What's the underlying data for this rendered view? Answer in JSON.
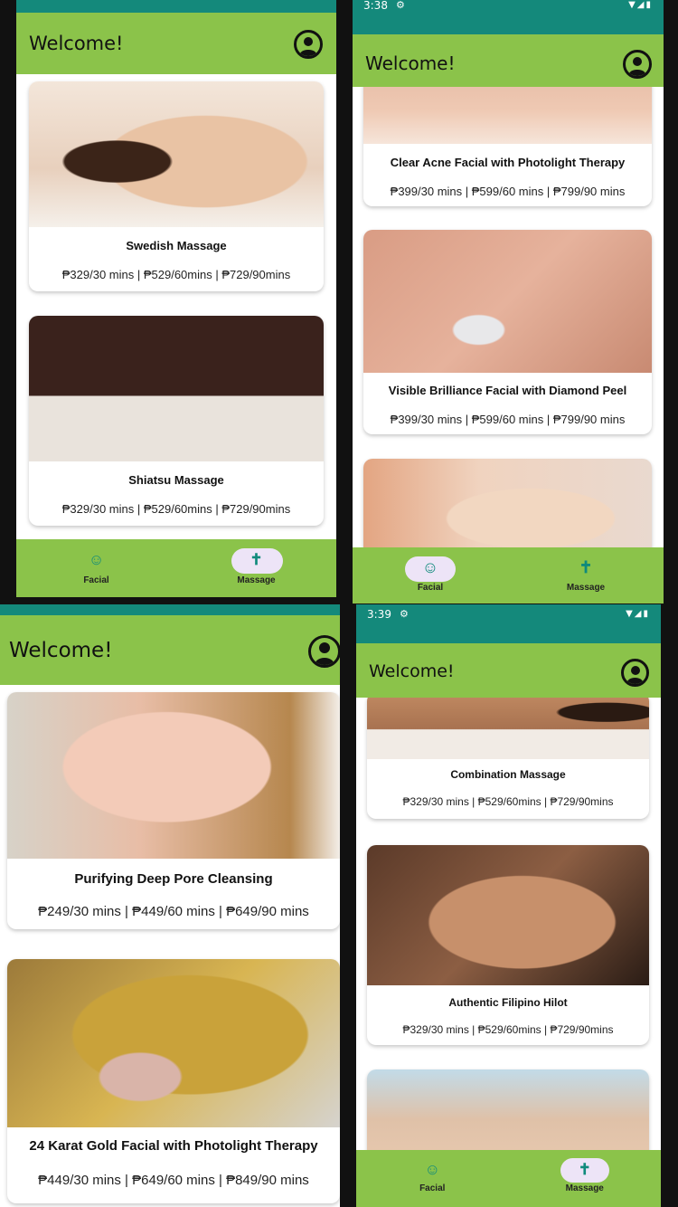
{
  "app": {
    "welcome": "Welcome!"
  },
  "status_top": {
    "time": "3:38"
  },
  "status_bottom": {
    "time": "3:39"
  },
  "nav": {
    "facial_label": "Facial",
    "massage_label": "Massage",
    "facial_icon": "face-icon",
    "massage_icon": "person-icon"
  },
  "colors": {
    "status": "#14897b",
    "appbar": "#8bc34a",
    "accent": "#0f8a7c",
    "active_pill": "#ede4f7"
  },
  "panel_tl": {
    "active_tab": "Massage",
    "cards": [
      {
        "name": "Swedish Massage",
        "price": "₱329/30 mins | ₱529/60mins | ₱729/90mins"
      },
      {
        "name": "Shiatsu Massage",
        "price": "₱329/30 mins | ₱529/60mins | ₱729/90mins"
      }
    ]
  },
  "panel_tr": {
    "active_tab": "Facial",
    "cards": [
      {
        "name": "Clear Acne Facial with Photolight Therapy",
        "price": "₱399/30 mins | ₱599/60 mins | ₱799/90 mins"
      },
      {
        "name": "Visible Brilliance Facial with Diamond Peel",
        "price": "₱399/30 mins | ₱599/60 mins | ₱799/90 mins"
      }
    ]
  },
  "panel_bl": {
    "cards": [
      {
        "name": "Purifying Deep Pore Cleansing",
        "price": "₱249/30 mins | ₱449/60 mins | ₱649/90 mins"
      },
      {
        "name": "24 Karat Gold Facial with Photolight Therapy",
        "price": "₱449/30 mins | ₱649/60 mins | ₱849/90 mins"
      }
    ]
  },
  "panel_br": {
    "active_tab": "Massage",
    "cards": [
      {
        "name": "Combination Massage",
        "price": "₱329/30 mins | ₱529/60mins | ₱729/90mins"
      },
      {
        "name": "Authentic Filipino Hilot",
        "price": "₱329/30 mins | ₱529/60mins | ₱729/90mins"
      }
    ]
  }
}
